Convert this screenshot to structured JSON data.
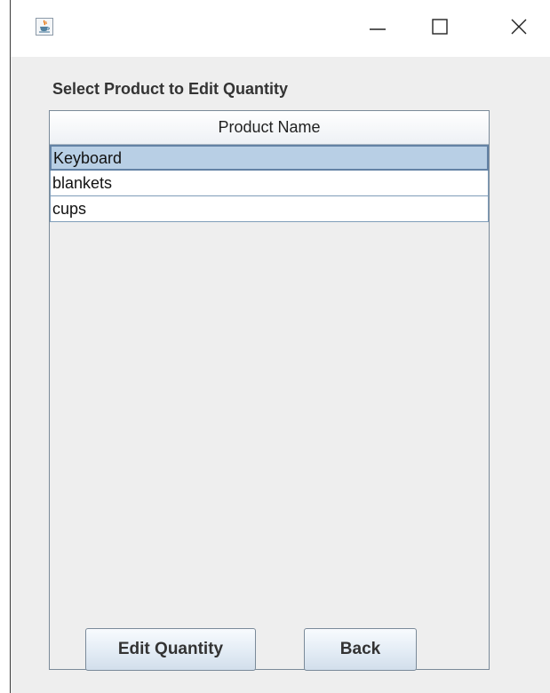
{
  "window": {
    "icon": "java-coffee-cup-icon",
    "controls": {
      "minimize_icon": "minimize-icon",
      "maximize_icon": "maximize-icon",
      "close_icon": "close-icon"
    }
  },
  "main": {
    "heading": "Select Product to Edit Quantity",
    "table": {
      "columns": [
        "Product Name"
      ],
      "rows": [
        {
          "product_name": "Keyboard",
          "selected": true
        },
        {
          "product_name": "blankets",
          "selected": false
        },
        {
          "product_name": "cups",
          "selected": false
        }
      ]
    },
    "buttons": {
      "edit_label": "Edit Quantity",
      "back_label": "Back"
    }
  },
  "colors": {
    "background": "#eeeeee",
    "selection": "#b8cfe5",
    "selection_border": "#6382a5"
  }
}
